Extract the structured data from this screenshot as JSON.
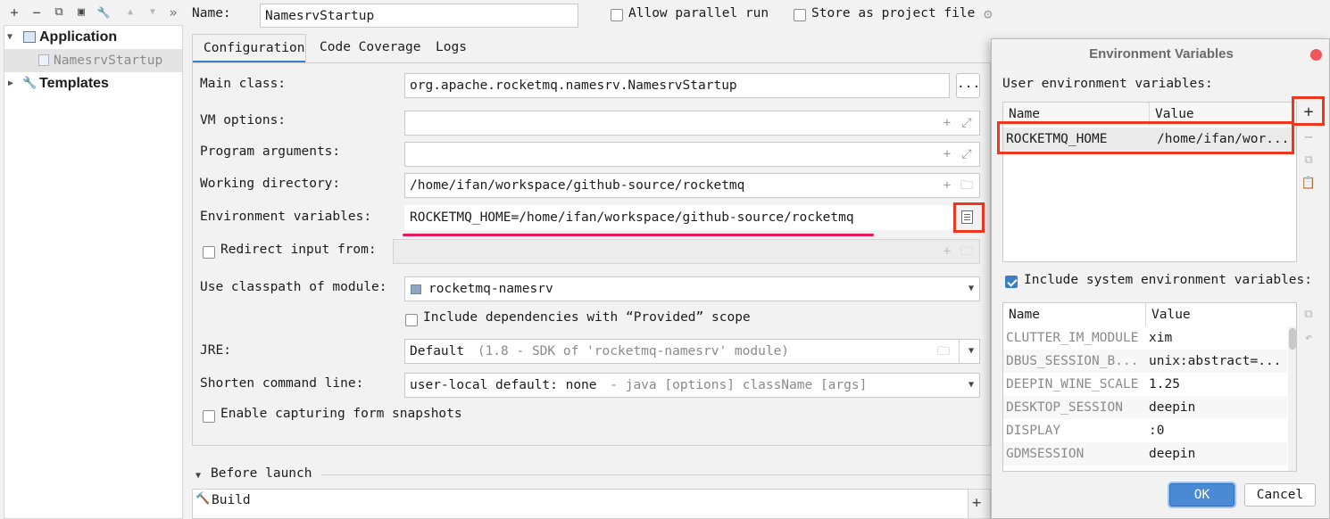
{
  "toolbar": {
    "add": "+",
    "remove": "−",
    "copy": "⧉",
    "save": "▣",
    "wrench": "🔧",
    "up": "▲",
    "down": "▼",
    "more": "»"
  },
  "tree": {
    "application": "Application",
    "namesrv": "NamesrvStartup",
    "templates": "Templates"
  },
  "header": {
    "name_label": "Name:",
    "name_value": "NamesrvStartup",
    "allow_parallel": "Allow parallel run",
    "store_project": "Store as project file"
  },
  "tabs": [
    "Configuration",
    "Code Coverage",
    "Logs"
  ],
  "form": {
    "main_class_label": "Main class:",
    "main_class_value": "org.apache.rocketmq.namesrv.NamesrvStartup",
    "browse": "...",
    "vm_options_label": "VM options:",
    "program_args_label": "Program arguments:",
    "working_dir_label": "Working directory:",
    "working_dir_value": "/home/ifan/workspace/github-source/rocketmq",
    "env_label": "Environment variables:",
    "env_value": "ROCKETMQ_HOME=/home/ifan/workspace/github-source/rocketmq",
    "redirect_label": "Redirect input from:",
    "classpath_label": "Use classpath of module:",
    "classpath_value": "rocketmq-namesrv",
    "include_deps": "Include dependencies with “Provided” scope",
    "jre_label": "JRE:",
    "jre_value": "Default",
    "jre_hint": "(1.8 - SDK of 'rocketmq-namesrv' module)",
    "shorten_label": "Shorten command line:",
    "shorten_value": "user-local default: none",
    "shorten_hint": "- java [options] className [args]",
    "enable_capture": "Enable capturing form snapshots"
  },
  "before_launch": {
    "title": "Before launch",
    "build": "Build",
    "add": "+"
  },
  "dialog": {
    "title": "Environment Variables",
    "user_label": "User environment variables:",
    "col_name": "Name",
    "col_value": "Value",
    "user_rows": [
      {
        "name": "ROCKETMQ_HOME",
        "value": "/home/ifan/wor..."
      }
    ],
    "include_system": "Include system environment variables:",
    "system_rows": [
      {
        "name": "CLUTTER_IM_MODULE",
        "value": "xim"
      },
      {
        "name": "DBUS_SESSION_B...",
        "value": "unix:abstract=..."
      },
      {
        "name": "DEEPIN_WINE_SCALE",
        "value": "1.25"
      },
      {
        "name": "DESKTOP_SESSION",
        "value": "deepin"
      },
      {
        "name": "DISPLAY",
        "value": ":0"
      },
      {
        "name": "GDMSESSION",
        "value": "deepin"
      }
    ],
    "ok": "OK",
    "cancel": "Cancel"
  },
  "colors": {
    "highlight": "#f2361d",
    "underline": "#e8175d",
    "accent": "#3d7fc6"
  }
}
